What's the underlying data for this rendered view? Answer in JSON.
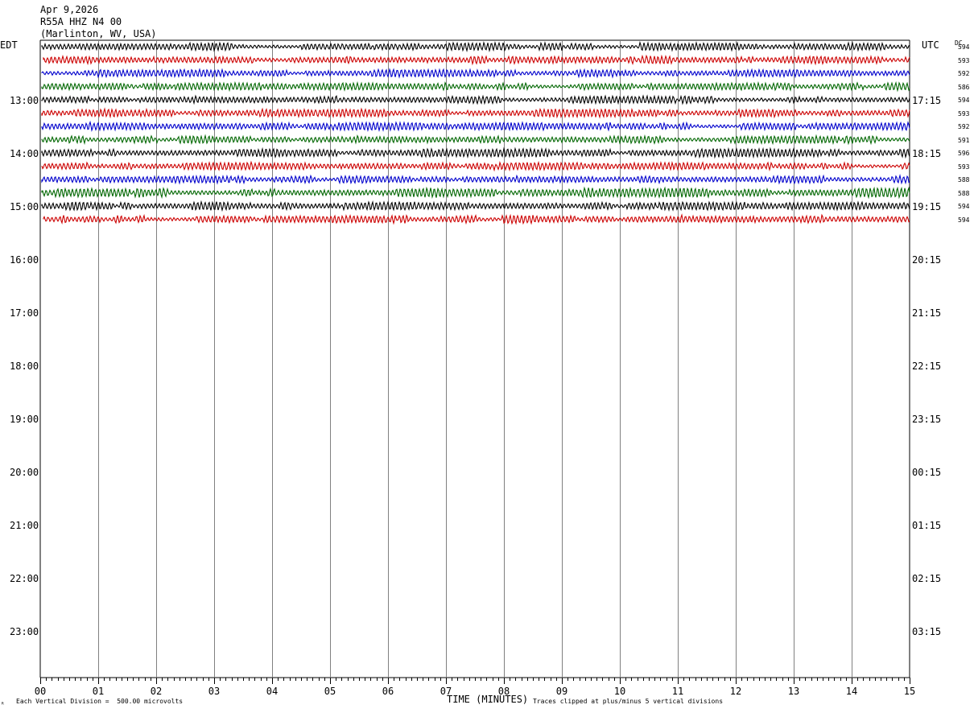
{
  "header": {
    "date": "Apr 9,2026",
    "station": "R55A HHZ N4 00",
    "location": "(Marlinton, WV, USA)"
  },
  "left_tz": "EDT",
  "right_tz": "UTC",
  "dc_label": "DC",
  "left_hours": [
    "13:00",
    "14:00",
    "15:00",
    "16:00",
    "17:00",
    "18:00",
    "19:00",
    "20:00",
    "21:00",
    "22:00",
    "23:00"
  ],
  "right_hours": [
    "17:15",
    "18:15",
    "19:15",
    "20:15",
    "21:15",
    "22:15",
    "23:15",
    "00:15",
    "01:15",
    "02:15",
    "03:15"
  ],
  "footer": {
    "scale_note": "Each Vertical Division =  500.00 microvolts",
    "x_title": "TIME (MINUTES)",
    "clip_note": "Traces clipped at plus/minus 5 vertical divisions",
    "corner_mark": "ᴿ"
  },
  "chart_data": {
    "type": "line",
    "title": "",
    "xlabel": "TIME (MINUTES)",
    "xlim": [
      0,
      15
    ],
    "x_ticks": [
      "00",
      "01",
      "02",
      "03",
      "04",
      "05",
      "06",
      "07",
      "08",
      "09",
      "10",
      "11",
      "12",
      "13",
      "14",
      "15"
    ],
    "trace_colors": [
      "#000000",
      "#cc0000",
      "#0000cc",
      "#006600"
    ],
    "grid_vertical": true,
    "traces": [
      {
        "row": 0,
        "color": "#000000",
        "dc": "594",
        "amplitude": 3.0
      },
      {
        "row": 1,
        "color": "#cc0000",
        "dc": "593",
        "amplitude": 3.0
      },
      {
        "row": 2,
        "color": "#0000cc",
        "dc": "592",
        "amplitude": 2.8
      },
      {
        "row": 3,
        "color": "#006600",
        "dc": "586",
        "amplitude": 3.0
      },
      {
        "row": 4,
        "color": "#000000",
        "dc": "594",
        "amplitude": 3.0
      },
      {
        "row": 5,
        "color": "#cc0000",
        "dc": "593",
        "amplitude": 3.0
      },
      {
        "row": 6,
        "color": "#0000cc",
        "dc": "592",
        "amplitude": 3.2
      },
      {
        "row": 7,
        "color": "#006600",
        "dc": "591",
        "amplitude": 3.0
      },
      {
        "row": 8,
        "color": "#000000",
        "dc": "596",
        "amplitude": 3.2
      },
      {
        "row": 9,
        "color": "#cc0000",
        "dc": "593",
        "amplitude": 3.0
      },
      {
        "row": 10,
        "color": "#0000cc",
        "dc": "588",
        "amplitude": 3.0
      },
      {
        "row": 11,
        "color": "#006600",
        "dc": "588",
        "amplitude": 3.6
      },
      {
        "row": 12,
        "color": "#000000",
        "dc": "594",
        "amplitude": 3.2
      },
      {
        "row": 13,
        "color": "#cc0000",
        "dc": "594",
        "amplitude": 3.2
      }
    ]
  }
}
